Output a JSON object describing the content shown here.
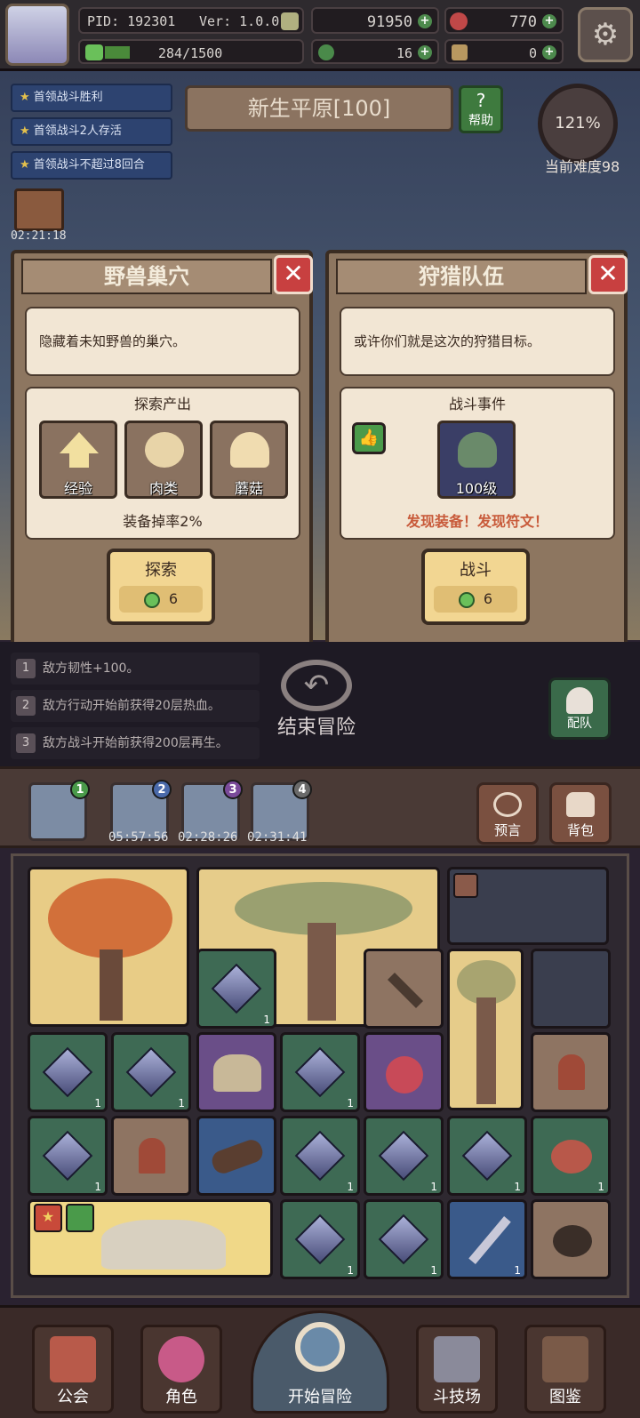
{
  "header": {
    "pid": "PID: 192301",
    "version": "Ver: 1.0.0.1",
    "exp": "284/1500",
    "gold": "91950",
    "gems": "770",
    "clover": "16",
    "keys": "0"
  },
  "objectives": [
    "首领战斗胜利",
    "首领战斗2人存活",
    "首领战斗不超过8回合"
  ],
  "location": "新生平原[100]",
  "help_label": "帮助",
  "difficulty": {
    "percent": "121%",
    "label": "当前难度98"
  },
  "chest_timer": "02:21:18",
  "cards": [
    {
      "title": "野兽巢穴",
      "close": "✕",
      "desc": "隐藏着未知野兽的巢穴。",
      "section_title": "探索产出",
      "items": [
        "经验",
        "肉类",
        "蘑菇"
      ],
      "footer": "装备掉率2%",
      "button": "探索",
      "cost": "6"
    },
    {
      "title": "狩猎队伍",
      "close": "✕",
      "desc": "或许你们就是这次的狩猎目标。",
      "section_title": "战斗事件",
      "enemy_level": "100级",
      "footer": "发现装备！发现符文！",
      "button": "战斗",
      "cost": "6"
    }
  ],
  "rules": [
    {
      "num": "1",
      "text": "敌方韧性+100。"
    },
    {
      "num": "2",
      "text": "敌方行动开始前获得20层热血。"
    },
    {
      "num": "3",
      "text": "敌方战斗开始前获得200层再生。"
    }
  ],
  "end_adventure": "结束冒险",
  "squad_label": "配队",
  "zones": [
    {
      "badge": "1",
      "time": ""
    },
    {
      "badge": "2",
      "time": "05:57:56"
    },
    {
      "badge": "3",
      "time": "02:28:26"
    },
    {
      "badge": "4",
      "time": "02:31:41"
    }
  ],
  "prophecy_label": "预言",
  "bag_label": "背包",
  "grid_count": "1",
  "nav": [
    "公会",
    "角色",
    "开始冒险",
    "斗技场",
    "图鉴"
  ],
  "colors": {
    "accent_red": "#c84040",
    "event_text": "#c85a3a",
    "crystal": "#aab0d8"
  }
}
